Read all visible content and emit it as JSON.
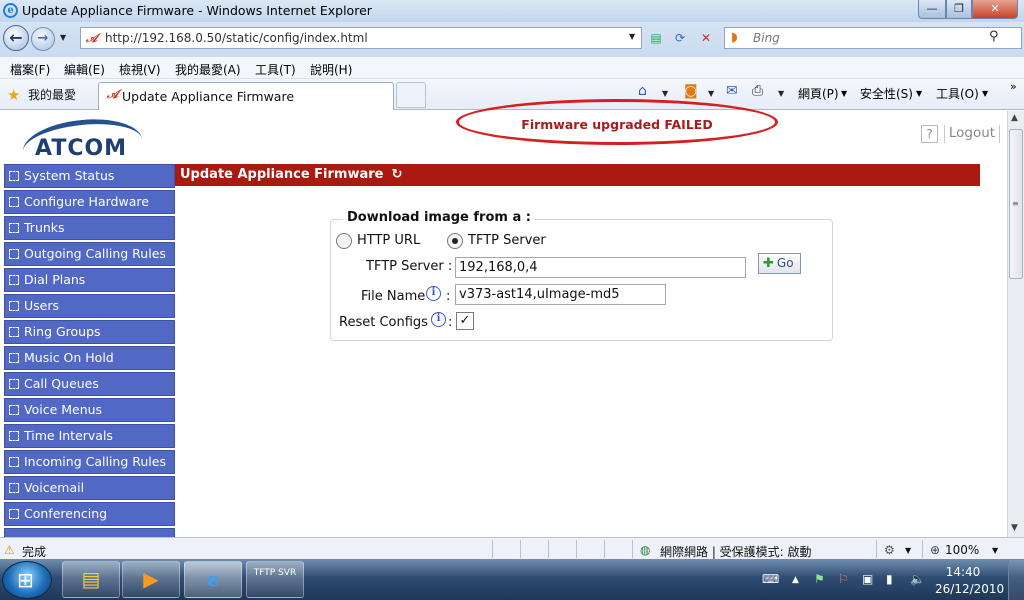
{
  "window": {
    "title": "Update Appliance Firmware - Windows Internet Explorer",
    "minimize": "—",
    "maximize": "❐",
    "close": "✕"
  },
  "address_bar": {
    "url": "http://192.168.0.50/static/config/index.html",
    "search_placeholder": "Bing"
  },
  "menu": [
    "檔案(F)",
    "編輯(E)",
    "檢視(V)",
    "我的最愛(A)",
    "工具(T)",
    "說明(H)"
  ],
  "favorites_label": "我的最愛",
  "tab": {
    "title": "Update Appliance Firmware"
  },
  "command_bar": {
    "page": "網頁(P)",
    "safety": "安全性(S)",
    "tools": "工具(O)"
  },
  "page": {
    "logo_text": "ATCOM",
    "alert": "Firmware upgraded FAILED",
    "help_label": "?",
    "logout_label": "Logout",
    "header": "Update Appliance Firmware",
    "sidebar": [
      "System Status",
      "Configure Hardware",
      "Trunks",
      "Outgoing Calling Rules",
      "Dial Plans",
      "Users",
      "Ring Groups",
      "Music On Hold",
      "Call Queues",
      "Voice Menus",
      "Time Intervals",
      "Incoming Calling Rules",
      "Voicemail",
      "Conferencing"
    ],
    "form": {
      "legend": "Download image from a :",
      "option_http": "HTTP URL",
      "option_tftp": "TFTP Server",
      "selected": "TFTP Server",
      "tftp_label": "TFTP Server :",
      "tftp_value": "192,168,0,4",
      "file_label": "File Name",
      "file_value": "v373-ast14,uImage-md5",
      "reset_label": "Reset Configs",
      "reset_checked": true,
      "go_label": "Go"
    }
  },
  "status_bar": {
    "status": "完成",
    "zone": "網際網路 | 受保護模式: 啟動",
    "zoom": "100%"
  },
  "taskbar": {
    "tftp_label": "TFTP SVR",
    "time": "14:40",
    "date": "26/12/2010"
  },
  "colors": {
    "sidebar": "#5168c4",
    "header_bar": "#aa1a10",
    "alert_text": "#a51d1d",
    "alert_ring": "#d81f1f"
  }
}
